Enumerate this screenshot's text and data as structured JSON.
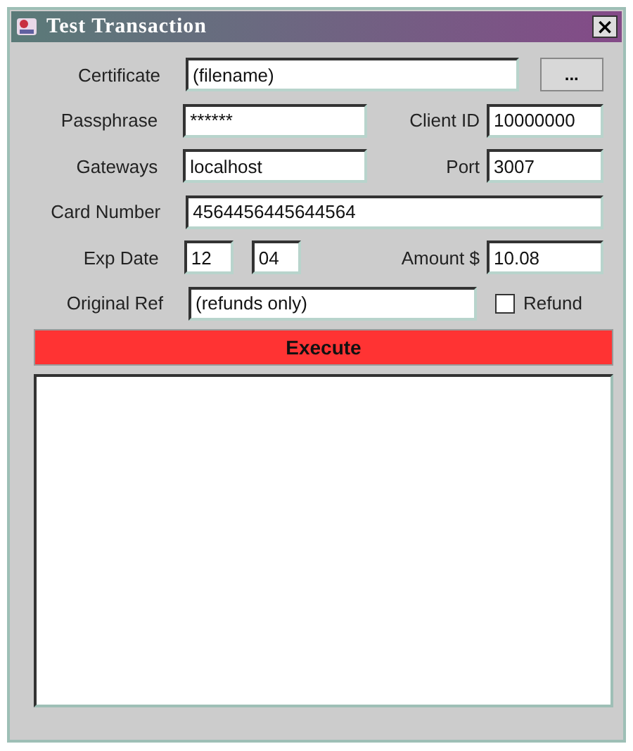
{
  "window": {
    "title": "Test Transaction",
    "close": "×"
  },
  "certificate": {
    "label": "Certificate",
    "value": "(filename)",
    "browse": "..."
  },
  "passphrase": {
    "label": "Passphrase",
    "value": "******"
  },
  "client_id": {
    "label": "Client ID",
    "value": "10000000"
  },
  "gateways": {
    "label": "Gateways",
    "value": "localhost"
  },
  "port": {
    "label": "Port",
    "value": "3007"
  },
  "card_number": {
    "label": "Card Number",
    "value": "4564456445644564"
  },
  "exp_date": {
    "label": "Exp Date",
    "month": "12",
    "year": "04"
  },
  "amount": {
    "label": "Amount $",
    "value": "10.08"
  },
  "original_ref": {
    "label": "Original Ref",
    "value": "(refunds only)"
  },
  "refund": {
    "label": "Refund",
    "checked": false
  },
  "execute": {
    "label": "Execute"
  }
}
